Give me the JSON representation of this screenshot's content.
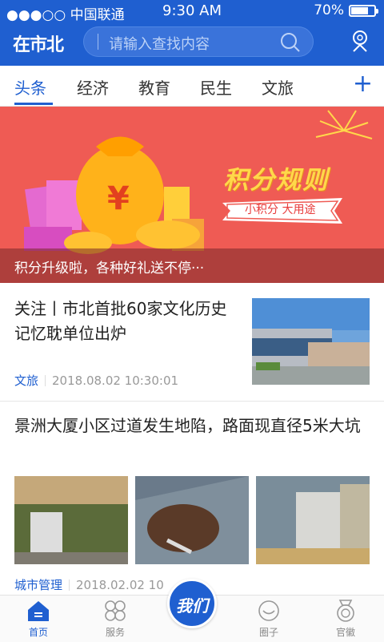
{
  "status": {
    "carrier": "●●●○○ 中国联通",
    "time": "9:30 AM",
    "battery": "70%",
    "battery_level": 0.7
  },
  "header": {
    "logo": "在市北",
    "search_placeholder": "请输入查找内容",
    "search_icon": "search-icon",
    "user_icon": "user-icon"
  },
  "tabs": {
    "items": [
      "头条",
      "经济",
      "教育",
      "民生",
      "文旅"
    ],
    "active": "头条",
    "add_icon": "plus-icon"
  },
  "banner": {
    "title": "积分规则",
    "subtitle": "小积分 大用途",
    "caption": "积分升级啦，各种好礼送不停···",
    "colors": {
      "background": "#ef5b54",
      "title": "#ffd84a"
    }
  },
  "articles": [
    {
      "title": "关注丨市北首批60家文化历史记忆耽单位出炉",
      "category": "文旅",
      "date": "2018.08.02 10:30:01"
    },
    {
      "title": "景洲大厦小区过道发生地陷，路面现直径5米大坑",
      "category": "城市管理",
      "date": "2018.02.02 10"
    }
  ],
  "bottom_nav": {
    "items": [
      {
        "label": "首页",
        "icon": "home-icon",
        "active": true
      },
      {
        "label": "服务",
        "icon": "services-icon",
        "active": false
      },
      {
        "label": "圈子",
        "icon": "chat-icon",
        "active": false
      },
      {
        "label": "官徽",
        "icon": "medal-icon",
        "active": false
      }
    ],
    "center_label": "我们"
  },
  "colors": {
    "primary": "#1f5fd0"
  }
}
